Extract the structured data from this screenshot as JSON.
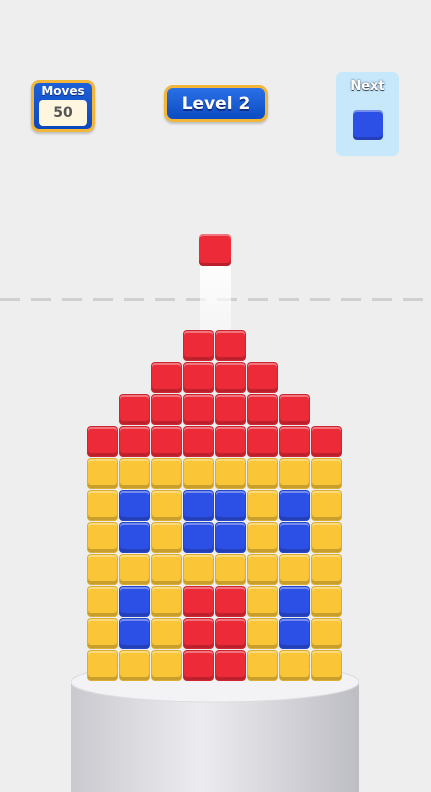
{
  "hud": {
    "moves_label": "Moves",
    "moves_value": "50",
    "level_label": "Level 2",
    "next_label": "Next",
    "next_color": "#2c50e6"
  },
  "falling_block": {
    "color": "red"
  },
  "colors": {
    "R": "#ec2a38",
    "Y": "#fac637",
    "B": "#2c50e6",
    "pedestal_top": "#f1f1f4",
    "pedestal_side": "#d9d9de"
  },
  "structure": {
    "columns": 8,
    "rows": [
      "...RR...",
      "..RRRR..",
      ".RRRRRR.",
      "RRRRRRRR",
      "YYYYYYYY",
      "YBYBBYBY",
      "YBYBBYBY",
      "YYYYYYYY",
      "YBYRRYBY",
      "YBYRRYBY",
      "YYYRRYYY"
    ]
  }
}
